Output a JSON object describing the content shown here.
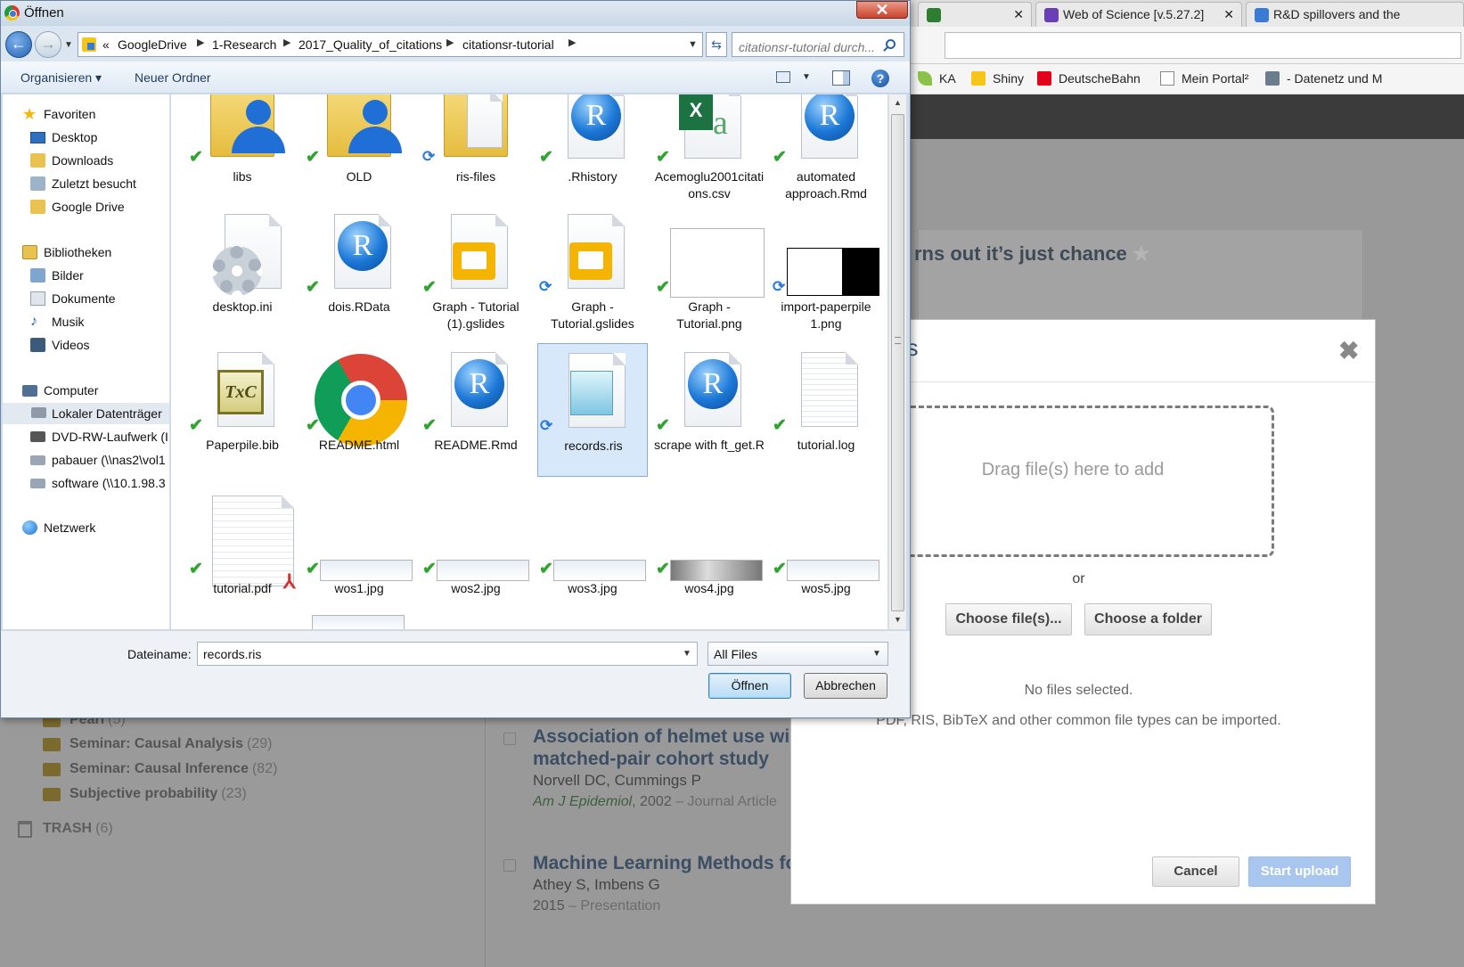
{
  "browser": {
    "tabs": [
      {
        "label": "",
        "color": "#2e7d32"
      },
      {
        "label": "Web of Science [v.5.27.2]",
        "color": "#6a3fb5"
      },
      {
        "label": "R&D spillovers and the",
        "color": "#3a7bd5"
      }
    ],
    "tab_close_glyph": "✕",
    "bookmarks": [
      "KA",
      "Shiny",
      "DeutscheBahn",
      "Mein Portal²",
      "- Datenetz und M"
    ]
  },
  "library": {
    "folders": [
      {
        "name": "Pearl",
        "count": "(5)"
      },
      {
        "name": "Seminar: Causal Analysis",
        "count": "(29)"
      },
      {
        "name": "Seminar: Causal Inference",
        "count": "(82)"
      },
      {
        "name": "Subjective probability",
        "count": "(23)"
      }
    ],
    "trash": {
      "name": "TRASH",
      "count": "(6)"
    },
    "card_title": "rns out it’s just chance",
    "star": "★",
    "items": [
      {
        "title1": "Association of helmet use wi",
        "title2": "matched-pair cohort study",
        "authors": "Norvell DC, Cummings P",
        "journal": "Am J Epidemiol",
        "year": ", 2002",
        "type": " – Journal Article"
      },
      {
        "title1": "Machine Learning Methods fo",
        "title2": "",
        "authors": "Athey S, Imbens G",
        "journal": "",
        "year": "2015",
        "type": " – Presentation"
      }
    ]
  },
  "upload_modal": {
    "title": "es",
    "close_glyph": "✖",
    "drop_text": "Drag file(s) here to add",
    "or_text": "or",
    "choose_files_label": "Choose file(s)...",
    "choose_folder_label": "Choose a folder",
    "no_files_text": "No files selected.",
    "file_types_text": "PDF, RIS, BibTeX and other common file types can be imported.",
    "cancel_label": "Cancel",
    "start_upload_label": "Start upload",
    "start_upload_color": "#a9c7ee"
  },
  "dialog": {
    "title": "Öffnen",
    "close_glyph": "✕",
    "breadcrumb_prefix": "«",
    "breadcrumb": [
      "GoogleDrive",
      "1-Research",
      "2017_Quality_of_citations",
      "citationsr-tutorial"
    ],
    "search_placeholder": "citationsr-tutorial durch...",
    "toolbar": {
      "organize": "Organisieren ▾",
      "new_folder": "Neuer Ordner",
      "help": "?"
    },
    "nav": {
      "favorites_header": "Favoriten",
      "favorites": [
        "Desktop",
        "Downloads",
        "Zuletzt besucht",
        "Google Drive"
      ],
      "libraries_header": "Bibliotheken",
      "libraries": [
        "Bilder",
        "Dokumente",
        "Musik",
        "Videos"
      ],
      "computer_header": "Computer",
      "computer": [
        "Lokaler Datenträger",
        "DVD-RW-Laufwerk (I",
        "pabauer (\\\\nas2\\vol1",
        "software (\\\\10.1.98.3"
      ],
      "network_header": "Netzwerk"
    },
    "files": [
      {
        "name": "libs",
        "kind": "user-folder",
        "status": "synced"
      },
      {
        "name": "OLD",
        "kind": "user-folder",
        "status": "synced"
      },
      {
        "name": "ris-files",
        "kind": "folder",
        "status": "syncing"
      },
      {
        "name": ".Rhistory",
        "kind": "r",
        "status": "synced"
      },
      {
        "name": "Acemoglu2001citations.csv",
        "kind": "csv",
        "status": "synced"
      },
      {
        "name": "automated approach.Rmd",
        "kind": "r",
        "status": "synced"
      },
      {
        "name": "desktop.ini",
        "kind": "ini",
        "status": "none"
      },
      {
        "name": "dois.RData",
        "kind": "r",
        "status": "synced"
      },
      {
        "name": "Graph - Tutorial (1).gslides",
        "kind": "slides",
        "status": "synced"
      },
      {
        "name": "Graph - Tutorial.gslides",
        "kind": "slides",
        "status": "syncing"
      },
      {
        "name": "Graph - Tutorial.png",
        "kind": "png-diagram",
        "status": "synced"
      },
      {
        "name": "import-paperpile 1.png",
        "kind": "png-dark",
        "status": "syncing"
      },
      {
        "name": "Paperpile.bib",
        "kind": "bib",
        "status": "synced"
      },
      {
        "name": "README.html",
        "kind": "chrome",
        "status": "synced"
      },
      {
        "name": "README.Rmd",
        "kind": "r",
        "status": "synced"
      },
      {
        "name": "records.ris",
        "kind": "notepad",
        "status": "syncing",
        "selected": true
      },
      {
        "name": "scrape with ft_get.R",
        "kind": "r",
        "status": "synced"
      },
      {
        "name": "tutorial.log",
        "kind": "text",
        "status": "synced"
      },
      {
        "name": "tutorial.pdf",
        "kind": "pdf",
        "status": "synced"
      },
      {
        "name": "wos1.jpg",
        "kind": "screenshot",
        "status": "synced"
      },
      {
        "name": "wos2.jpg",
        "kind": "screenshot",
        "status": "synced"
      },
      {
        "name": "wos3.jpg",
        "kind": "screenshot",
        "status": "synced"
      },
      {
        "name": "wos4.jpg",
        "kind": "screenshot-dark",
        "status": "synced"
      },
      {
        "name": "wos5.jpg",
        "kind": "screenshot",
        "status": "synced"
      }
    ],
    "filename_label": "Dateiname:",
    "filename_value": "records.ris",
    "filetype_value": "All Files",
    "open_label": "Öffnen",
    "cancel_label": "Abbrechen",
    "status_icons": {
      "synced": "✔",
      "syncing": "⟳"
    }
  }
}
